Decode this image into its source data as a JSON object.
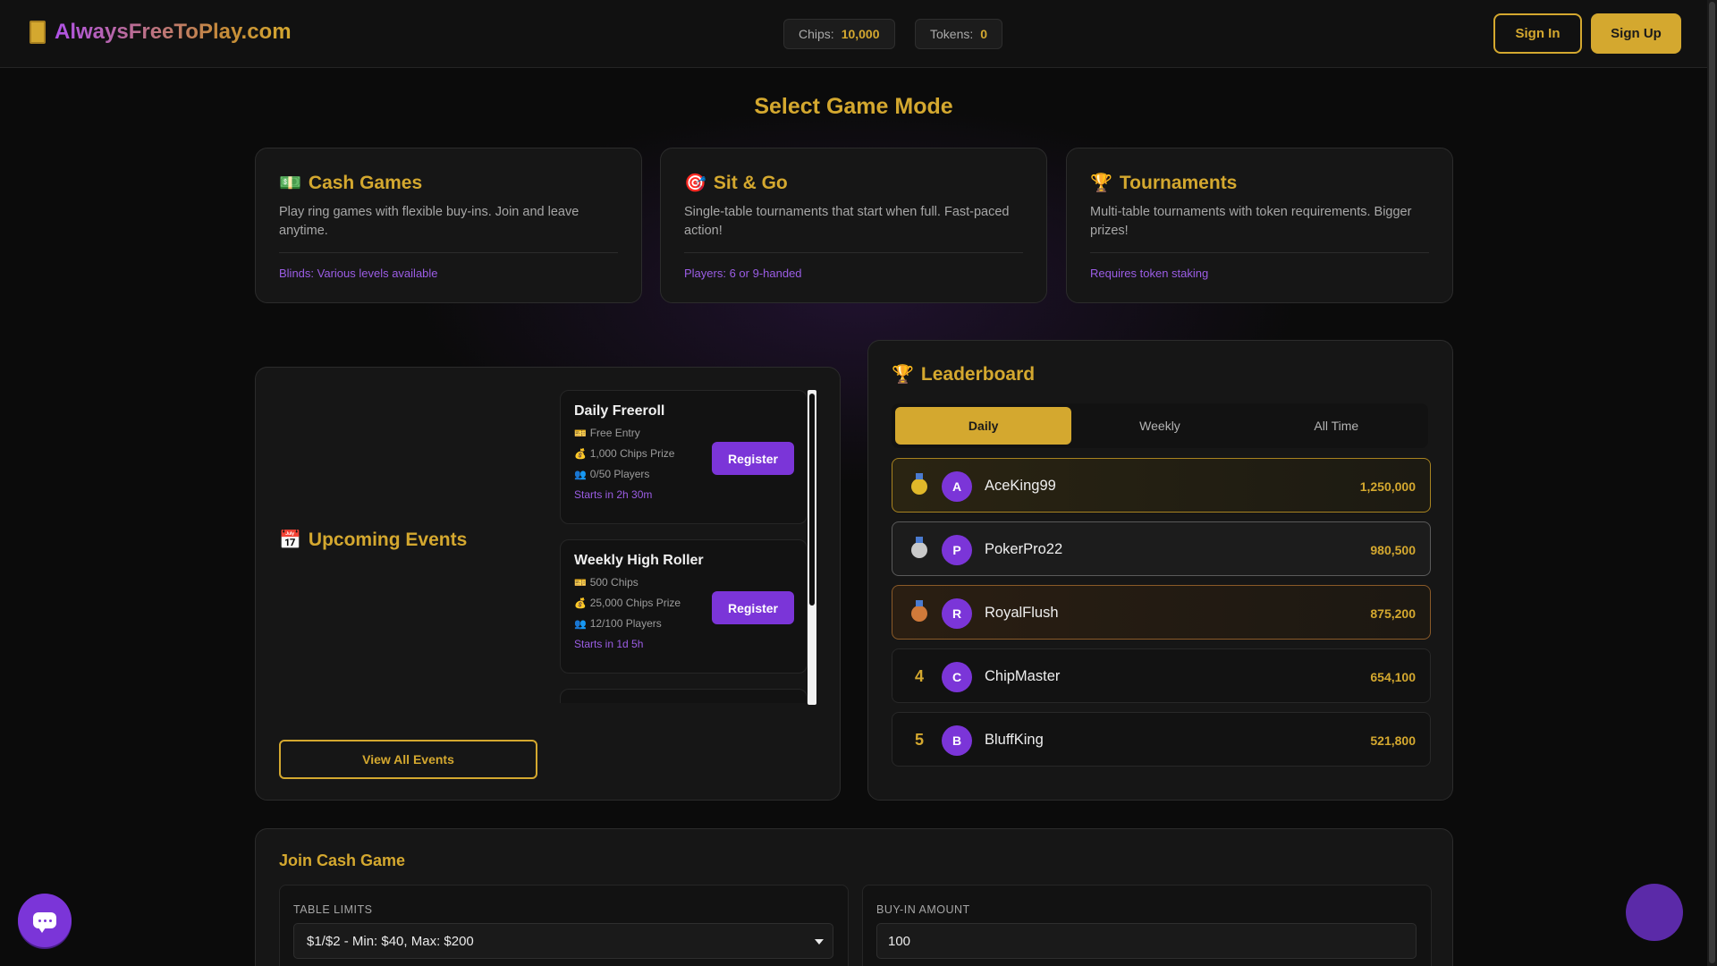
{
  "header": {
    "site_name": "AlwaysFreeToPlay.com",
    "chips_label": "Chips:",
    "chips_value": "10,000",
    "tokens_label": "Tokens:",
    "tokens_value": "0",
    "sign_in": "Sign In",
    "sign_up": "Sign Up"
  },
  "select_mode": {
    "title": "Select Game Mode",
    "modes": [
      {
        "icon": "💵",
        "icon_name": "cash-icon",
        "title": "Cash Games",
        "desc": "Play ring games with flexible buy-ins. Join and leave anytime.",
        "meta": "Blinds: Various levels available"
      },
      {
        "icon": "🎯",
        "icon_name": "target-icon",
        "title": "Sit & Go",
        "desc": "Single-table tournaments that start when full. Fast-paced action!",
        "meta": "Players: 6 or 9-handed"
      },
      {
        "icon": "🏆",
        "icon_name": "trophy-icon",
        "title": "Tournaments",
        "desc": "Multi-table tournaments with token requirements. Bigger prizes!",
        "meta": "Requires token staking"
      }
    ]
  },
  "events": {
    "icon": "📅",
    "title": "Upcoming Events",
    "view_all": "View All Events",
    "items": [
      {
        "name": "Daily Freeroll",
        "entry": "Free Entry",
        "prize": "1,000 Chips Prize",
        "players": "0/50 Players",
        "starts": "Starts in 2h 30m",
        "register": "Register"
      },
      {
        "name": "Weekly High Roller",
        "entry": "500 Chips",
        "prize": "25,000 Chips Prize",
        "players": "12/100 Players",
        "starts": "Starts in 1d 5h",
        "register": "Register"
      }
    ]
  },
  "leaderboard": {
    "icon": "🏆",
    "title": "Leaderboard",
    "tabs": [
      "Daily",
      "Weekly",
      "All Time"
    ],
    "active_tab": "Daily",
    "rows": [
      {
        "rank": "1",
        "medal": "gold",
        "initial": "A",
        "name": "AceKing99",
        "score": "1,250,000"
      },
      {
        "rank": "2",
        "medal": "silver",
        "initial": "P",
        "name": "PokerPro22",
        "score": "980,500"
      },
      {
        "rank": "3",
        "medal": "bronze",
        "initial": "R",
        "name": "RoyalFlush",
        "score": "875,200"
      },
      {
        "rank": "4",
        "medal": "",
        "initial": "C",
        "name": "ChipMaster",
        "score": "654,100"
      },
      {
        "rank": "5",
        "medal": "",
        "initial": "B",
        "name": "BluffKing",
        "score": "521,800"
      }
    ]
  },
  "join_cash": {
    "title": "Join Cash Game",
    "table_limits_label": "TABLE LIMITS",
    "table_limits_value": "$1/$2 - Min: $40, Max: $200",
    "buyin_label": "BUY-IN AMOUNT",
    "buyin_value": "100"
  },
  "colors": {
    "accent": "#d4a82f",
    "brand_purple": "#7b35d8",
    "background": "#0b0b0b"
  }
}
